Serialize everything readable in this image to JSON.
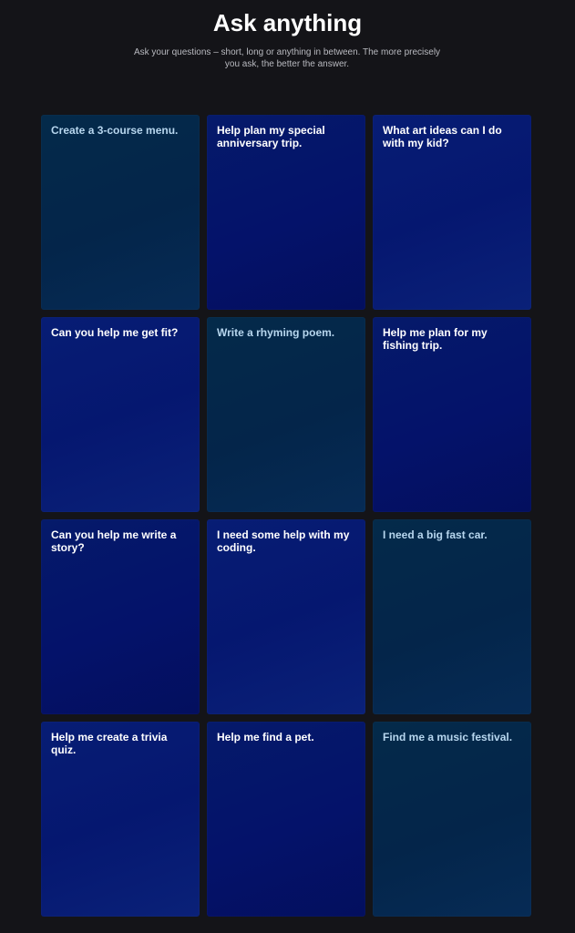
{
  "header": {
    "title": "Ask anything",
    "subtitle": "Ask your questions – short, long or anything in between. The more precisely you ask, the better the answer."
  },
  "cards": [
    {
      "label": "Create a 3-course menu.",
      "style": "teal"
    },
    {
      "label": "Help plan my special anniversary trip.",
      "style": "navy"
    },
    {
      "label": "What art ideas can I do with my kid?",
      "style": "navy2"
    },
    {
      "label": "Can you help me get fit?",
      "style": "navy2"
    },
    {
      "label": "Write a rhyming poem.",
      "style": "teal"
    },
    {
      "label": "Help me plan for my fishing trip.",
      "style": "navy"
    },
    {
      "label": "Can you help me write a story?",
      "style": "navy"
    },
    {
      "label": "I need some help with my coding.",
      "style": "navy2"
    },
    {
      "label": "I need a big fast car.",
      "style": "teal"
    },
    {
      "label": "Help me create a trivia quiz.",
      "style": "navy2"
    },
    {
      "label": "Help me find a pet.",
      "style": "navy"
    },
    {
      "label": "Find me a music festival.",
      "style": "teal"
    }
  ],
  "colors": {
    "background": "#141418",
    "teal_card": "#042a4a",
    "navy_card": "#04126a",
    "teal_text": "#b7d6ee",
    "navy_text": "#ffffff"
  }
}
